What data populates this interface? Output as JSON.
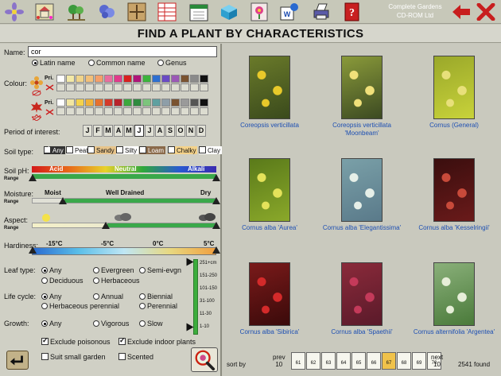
{
  "toolbar": {
    "brand_line1": "Complete Gardens",
    "brand_line2": "CD-ROM Ltd"
  },
  "page_title": "FIND A PLANT BY CHARACTERISTICS",
  "name": {
    "label": "Name:",
    "value": "cor",
    "options": [
      "Latin name",
      "Common name",
      "Genus"
    ],
    "selected": "Latin name"
  },
  "colour": {
    "label": "Colour:",
    "pri_label": "Pri.",
    "sec_label": "Sec.",
    "flower_palette": [
      "#ffffff",
      "#f3e9a6",
      "#f0d48a",
      "#f2c07a",
      "#f4a06a",
      "#e86e9e",
      "#e23a8a",
      "#d9201f",
      "#b01578",
      "#3cb33c",
      "#2d6fd1",
      "#6a4bc4",
      "#9b59b6",
      "#7a5330",
      "#8a8a8a",
      "#111111"
    ],
    "flower_sec": [
      "#dcdcd0",
      "#dcdcd0",
      "#dcdcd0",
      "#dcdcd0",
      "#dcdcd0",
      "#dcdcd0",
      "#dcdcd0",
      "#dcdcd0",
      "#dcdcd0",
      "#dcdcd0",
      "#dcdcd0",
      "#dcdcd0",
      "#dcdcd0",
      "#dcdcd0",
      "#dcdcd0",
      "#dcdcd0"
    ],
    "foliage_palette": [
      "#ffffff",
      "#f2e6a1",
      "#f4d24c",
      "#f0b23a",
      "#e6712f",
      "#d43a2a",
      "#b8232a",
      "#3da83d",
      "#2f8b3f",
      "#7cc47c",
      "#5fa0a0",
      "#8e9ea8",
      "#7a5330",
      "#9a9a9a",
      "#555555",
      "#111111"
    ],
    "foliage_sec": [
      "#dcdcd0",
      "#dcdcd0",
      "#dcdcd0",
      "#dcdcd0",
      "#dcdcd0",
      "#dcdcd0",
      "#dcdcd0",
      "#dcdcd0",
      "#dcdcd0",
      "#dcdcd0",
      "#dcdcd0",
      "#dcdcd0",
      "#dcdcd0",
      "#dcdcd0",
      "#dcdcd0",
      "#dcdcd0"
    ]
  },
  "period": {
    "label": "Period of interest:",
    "months": [
      "J",
      "F",
      "M",
      "A",
      "M",
      "J",
      "J",
      "A",
      "S",
      "O",
      "N",
      "D"
    ],
    "selected_index": 5
  },
  "soil": {
    "label": "Soil type:",
    "types": [
      {
        "name": "Any",
        "checked": true,
        "bg": "#333333",
        "color": "#ffffff"
      },
      {
        "name": "Peat",
        "checked": false,
        "bg": "#ffffff",
        "color": "#111111"
      },
      {
        "name": "Sandy",
        "checked": false,
        "bg": "#e7c48a",
        "color": "#111111"
      },
      {
        "name": "Silty",
        "checked": false,
        "bg": "#ffffff",
        "color": "#111111"
      },
      {
        "name": "Loam",
        "checked": false,
        "bg": "#8a6a4a",
        "color": "#ffffff"
      },
      {
        "name": "Chalky",
        "checked": false,
        "bg": "#f4d28a",
        "color": "#111111"
      },
      {
        "name": "Clay",
        "checked": false,
        "bg": "#ffffff",
        "color": "#111111"
      }
    ]
  },
  "soil_ph": {
    "label": "Soil pH:",
    "sub": "Range",
    "acid": "Acid",
    "neutral": "Neutral",
    "alkali": "Alkali"
  },
  "moisture": {
    "label": "Moisture:",
    "sub": "Range",
    "low": "Moist",
    "mid": "Well Drained",
    "high": "Dry"
  },
  "aspect": {
    "label": "Aspect:",
    "sub": "Range"
  },
  "hardiness": {
    "label": "Hardiness:",
    "ticks": [
      "-15°C",
      "-5°C",
      "0°C",
      "5°C"
    ]
  },
  "leaf_type": {
    "label": "Leaf type:",
    "options": [
      "Any",
      "Evergreen",
      "Semi-evgn",
      "Deciduous",
      "Herbaceous"
    ],
    "selected": "Any"
  },
  "life_cycle": {
    "label": "Life cycle:",
    "options": [
      "Any",
      "Annual",
      "Biennial",
      "Herbaceous perennial",
      "Perennial"
    ],
    "selected": "Any"
  },
  "growth": {
    "label": "Growth:",
    "options": [
      "Any",
      "Vigorous",
      "Slow"
    ],
    "selected": "Any"
  },
  "height_scale": [
    "251+cm",
    "151-250",
    "101-150",
    "31-100",
    "11-30",
    "1-10"
  ],
  "exclude_poisonous": {
    "label": "Exclude poisonous",
    "checked": true
  },
  "exclude_indoor": {
    "label": "Exclude indoor plants",
    "checked": true
  },
  "suit_small": {
    "label": "Suit small garden",
    "checked": false
  },
  "scented": {
    "label": "Scented",
    "checked": false
  },
  "plants": [
    {
      "name": "Coreopsis verticillata",
      "c1": "#3a4a1c",
      "c2": "#e8c92a",
      "c3": "#6a7a2a"
    },
    {
      "name": "Coreopsis verticillata 'Moonbeam'",
      "c1": "#3c4a22",
      "c2": "#f0e07a",
      "c3": "#8a9a3a"
    },
    {
      "name": "Cornus (General)",
      "c1": "#c8d23a",
      "c2": "#e8e07a",
      "c3": "#9aa82a"
    },
    {
      "name": "Cornus alba 'Aurea'",
      "c1": "#8aa82a",
      "c2": "#e4e25a",
      "c3": "#5a7a1a"
    },
    {
      "name": "Cornus alba 'Elegantissima'",
      "c1": "#5a7a8a",
      "c2": "#e6efe8",
      "c3": "#7aa0a8"
    },
    {
      "name": "Cornus alba 'Kesselringii'",
      "c1": "#6a1a1a",
      "c2": "#c84a3a",
      "c3": "#3a0e0e"
    },
    {
      "name": "Cornus alba 'Sibirica'",
      "c1": "#3a0a0a",
      "c2": "#d42a2a",
      "c3": "#7a1a1a"
    },
    {
      "name": "Cornus alba 'Spaethii'",
      "c1": "#5a1a2a",
      "c2": "#c43a5a",
      "c3": "#8a2a3a"
    },
    {
      "name": "Cornus alternifolia 'Argentea'",
      "c1": "#4a7a3a",
      "c2": "#e6eed8",
      "c3": "#8ab07a"
    }
  ],
  "pager": {
    "sort_by": "sort by",
    "prev_label": "prev",
    "prev_count": "10",
    "next_label": "next",
    "next_count": "10",
    "pages": [
      "61",
      "62",
      "63",
      "64",
      "65",
      "66",
      "67",
      "68",
      "69",
      "70"
    ],
    "current": "67",
    "found": "2541 found"
  }
}
